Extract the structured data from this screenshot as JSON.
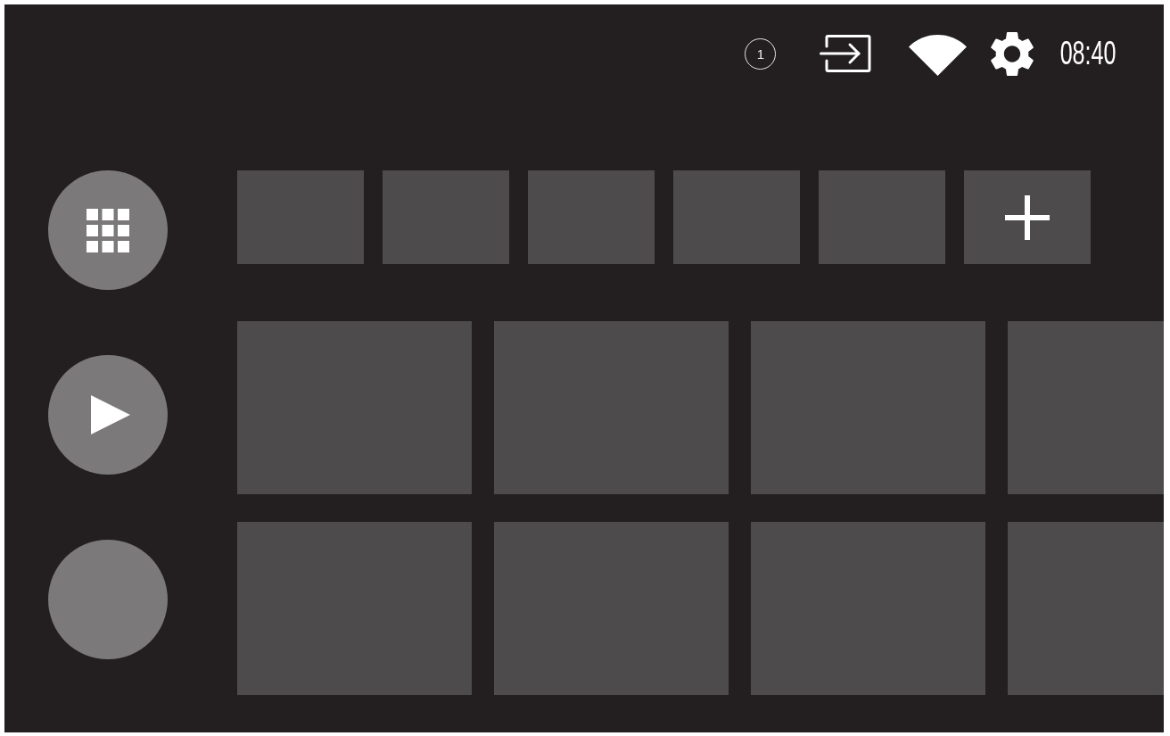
{
  "status_bar": {
    "notification_count": "1",
    "time": "08:40"
  },
  "sidebar": {
    "items": [
      {
        "kind": "apps"
      },
      {
        "kind": "play"
      },
      {
        "kind": "blank"
      }
    ]
  },
  "favorites": {
    "items": [
      {
        "kind": "app"
      },
      {
        "kind": "app"
      },
      {
        "kind": "app"
      },
      {
        "kind": "app"
      },
      {
        "kind": "app"
      },
      {
        "kind": "add"
      }
    ]
  },
  "rows": [
    {
      "cards": [
        {
          "kind": "card"
        },
        {
          "kind": "card"
        },
        {
          "kind": "card"
        },
        {
          "kind": "card"
        }
      ]
    },
    {
      "cards": [
        {
          "kind": "card"
        },
        {
          "kind": "card"
        },
        {
          "kind": "card"
        },
        {
          "kind": "card"
        }
      ]
    }
  ]
}
